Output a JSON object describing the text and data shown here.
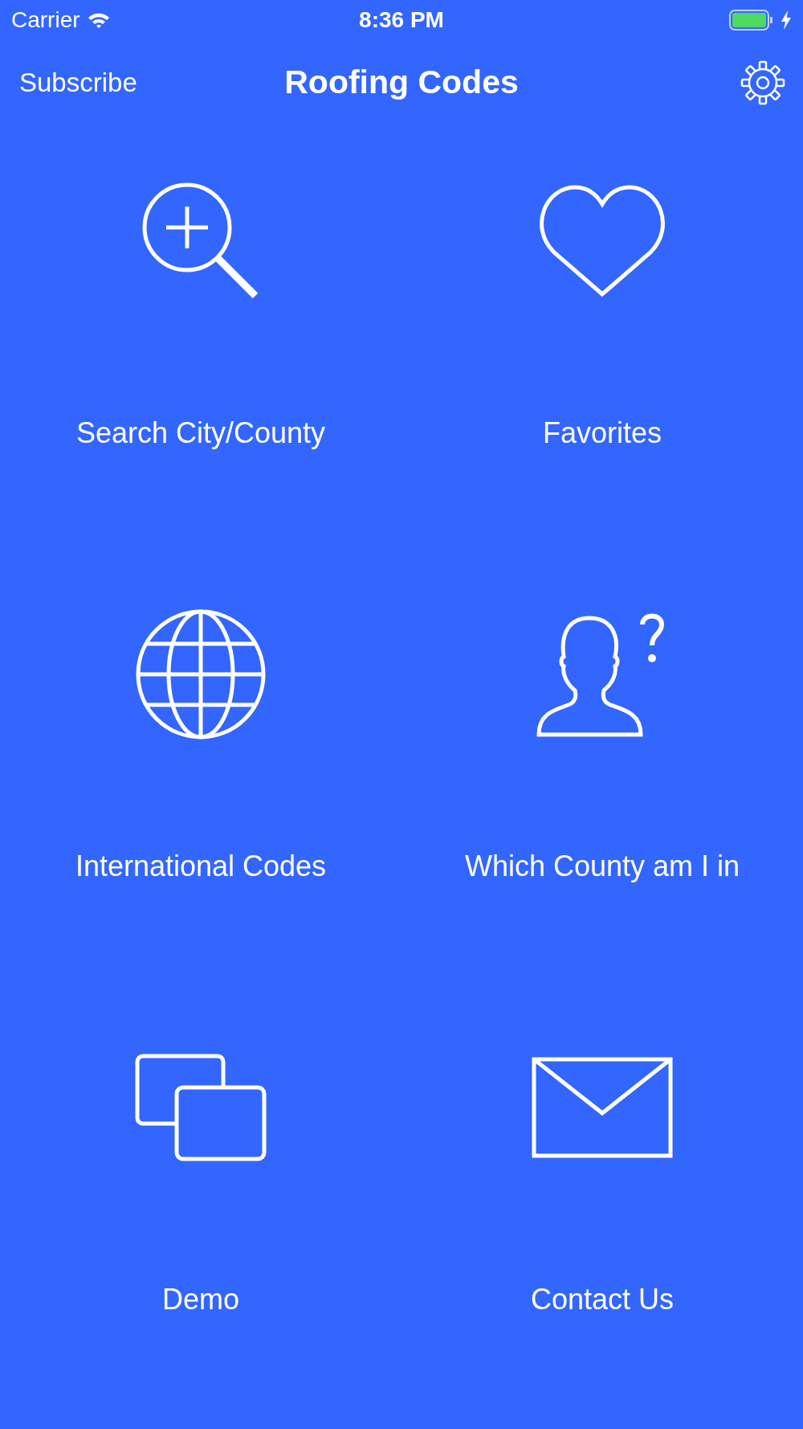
{
  "status_bar": {
    "carrier": "Carrier",
    "time": "8:36 PM"
  },
  "nav": {
    "left_button": "Subscribe",
    "title": "Roofing Codes"
  },
  "tiles": [
    {
      "label": "Search City/County"
    },
    {
      "label": "Favorites"
    },
    {
      "label": "International Codes"
    },
    {
      "label": "Which County am I in"
    },
    {
      "label": "Demo"
    },
    {
      "label": "Contact Us"
    }
  ]
}
